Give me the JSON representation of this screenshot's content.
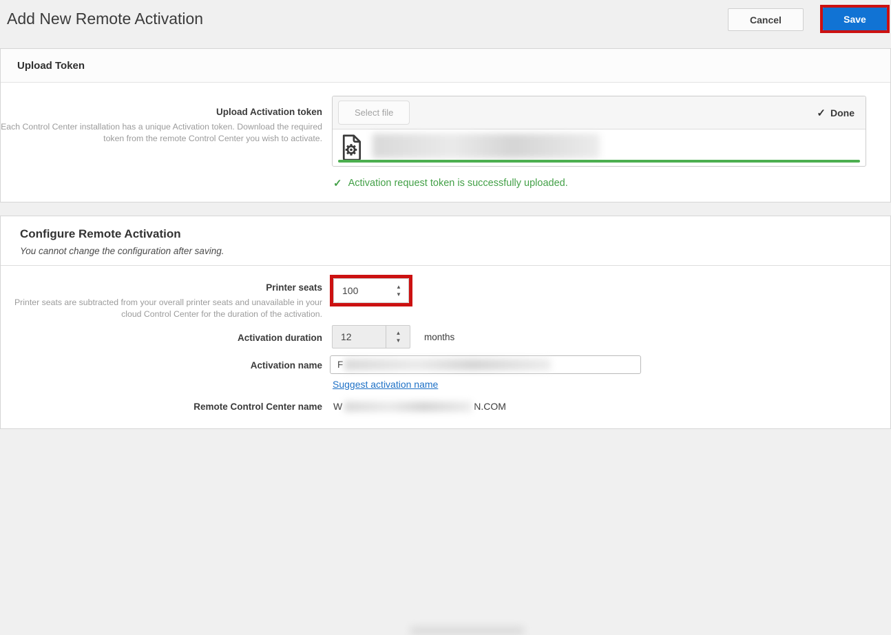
{
  "page": {
    "title": "Add New Remote Activation",
    "cancel_label": "Cancel",
    "save_label": "Save"
  },
  "upload": {
    "heading": "Upload Token",
    "field_label": "Upload Activation token",
    "field_description": "Each Control Center installation has a unique Activation token. Download the required token from the remote Control Center you wish to activate.",
    "select_file_label": "Select file",
    "done_label": "Done",
    "success_message": "Activation request token is successfully uploaded."
  },
  "configure": {
    "heading": "Configure Remote Activation",
    "note": "You cannot change the configuration after saving.",
    "printer_seats": {
      "label": "Printer seats",
      "value": "100",
      "description": "Printer seats are subtracted from your overall printer seats and unavailable in your cloud Control Center for the duration of the activation."
    },
    "duration": {
      "label": "Activation duration",
      "value": "12",
      "unit": "months"
    },
    "activation_name": {
      "label": "Activation name",
      "value_visible_prefix": "F"
    },
    "suggest_link_label": "Suggest activation name",
    "remote_cc": {
      "label": "Remote Control Center name",
      "value_prefix": "W",
      "value_suffix": "N.COM"
    }
  },
  "icons": {
    "check": "✓",
    "spin_up": "▲",
    "spin_down": "▼"
  },
  "colors": {
    "accent_blue": "#1173d4",
    "annotation_red": "#cc1111",
    "progress_green": "#4caf50",
    "success_green": "#43a047",
    "link_blue": "#1d70c6"
  }
}
